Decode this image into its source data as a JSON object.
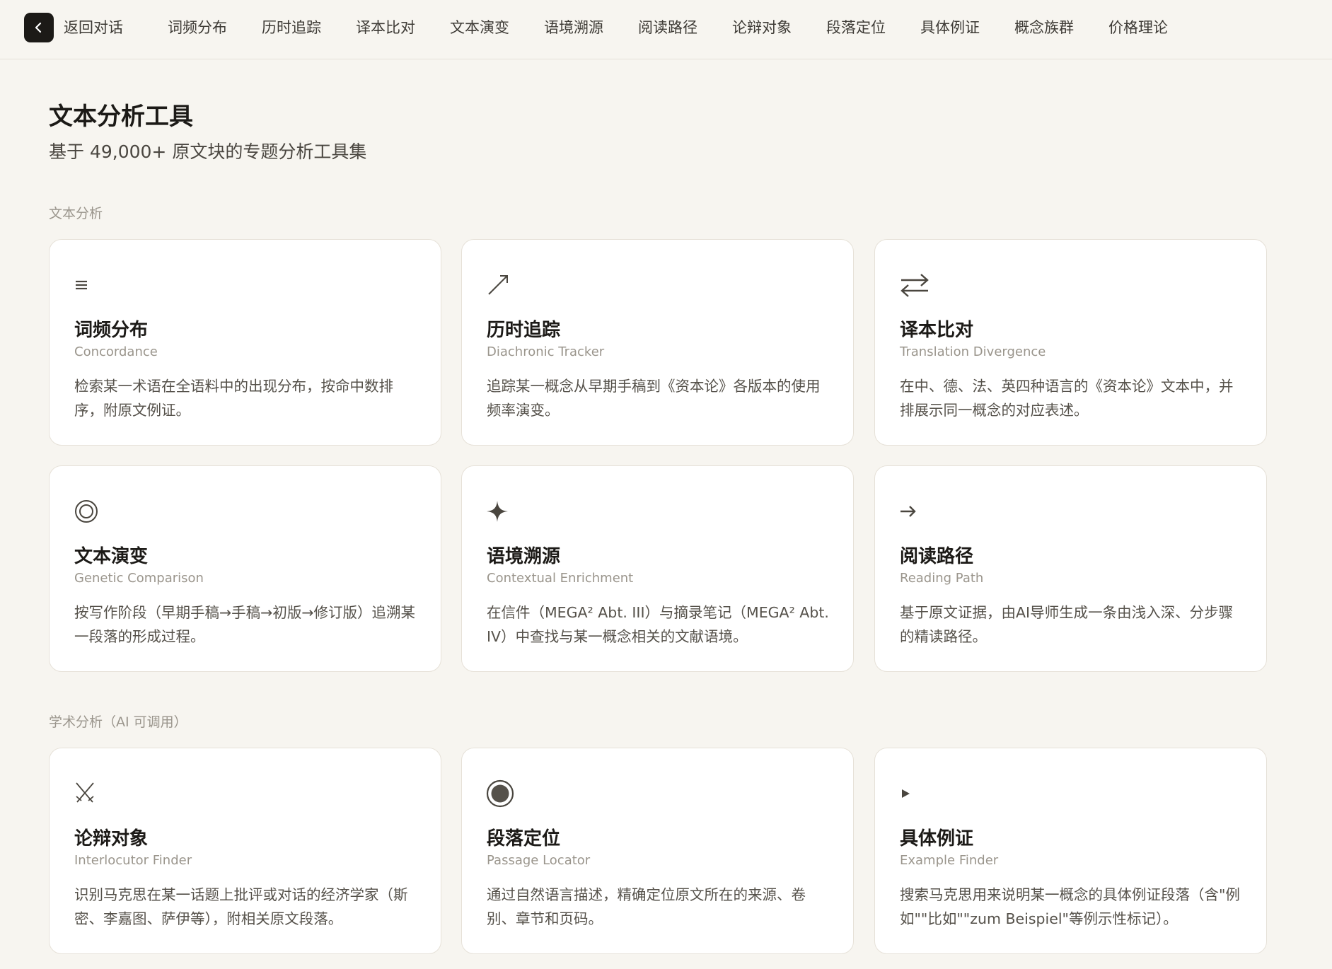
{
  "nav": {
    "back_label": "返回对话",
    "tabs": [
      "词频分布",
      "历时追踪",
      "译本比对",
      "文本演变",
      "语境溯源",
      "阅读路径",
      "论辩对象",
      "段落定位",
      "具体例证",
      "概念族群",
      "价格理论"
    ]
  },
  "header": {
    "title": "文本分析工具",
    "subtitle": "基于 49,000+ 原文块的专题分析工具集"
  },
  "sections": [
    {
      "label": "文本分析",
      "cards": [
        {
          "icon": "list-icon",
          "icon_glyph": "≡",
          "title": "词频分布",
          "subtitle": "Concordance",
          "description": "检索某一术语在全语料中的出现分布，按命中数排序，附原文例证。"
        },
        {
          "icon": "trend-arrow-icon",
          "icon_glyph": "",
          "title": "历时追踪",
          "subtitle": "Diachronic Tracker",
          "description": "追踪某一概念从早期手稿到《资本论》各版本的使用频率演变。"
        },
        {
          "icon": "swap-arrows-icon",
          "icon_glyph": "",
          "title": "译本比对",
          "subtitle": "Translation Divergence",
          "description": "在中、德、法、英四种语言的《资本论》文本中，并排展示同一概念的对应表述。"
        },
        {
          "icon": "concentric-circle-icon",
          "icon_glyph": "◎",
          "title": "文本演变",
          "subtitle": "Genetic Comparison",
          "description": "按写作阶段（早期手稿→手稿→初版→修订版）追溯某一段落的形成过程。"
        },
        {
          "icon": "sparkle-icon",
          "icon_glyph": "✦",
          "title": "语境溯源",
          "subtitle": "Contextual Enrichment",
          "description": "在信件（MEGA² Abt. III）与摘录笔记（MEGA² Abt. IV）中查找与某一概念相关的文献语境。"
        },
        {
          "icon": "right-arrow-icon",
          "icon_glyph": "→",
          "title": "阅读路径",
          "subtitle": "Reading Path",
          "description": "基于原文证据，由AI导师生成一条由浅入深、分步骤的精读路径。"
        }
      ]
    },
    {
      "label": "学术分析（AI 可调用）",
      "cards": [
        {
          "icon": "crossed-swords-icon",
          "icon_glyph": "⚔",
          "title": "论辩对象",
          "subtitle": "Interlocutor Finder",
          "description": "识别马克思在某一话题上批评或对话的经济学家（斯密、李嘉图、萨伊等），附相关原文段落。"
        },
        {
          "icon": "target-icon",
          "icon_glyph": "◉",
          "title": "段落定位",
          "subtitle": "Passage Locator",
          "description": "通过自然语言描述，精确定位原文所在的来源、卷别、章节和页码。"
        },
        {
          "icon": "play-triangle-icon",
          "icon_glyph": "▸",
          "title": "具体例证",
          "subtitle": "Example Finder",
          "description": "搜索马克思用来说明某一概念的具体例证段落（含\"例如\"\"比如\"\"zum Beispiel\"等例示性标记）。"
        }
      ]
    }
  ]
}
